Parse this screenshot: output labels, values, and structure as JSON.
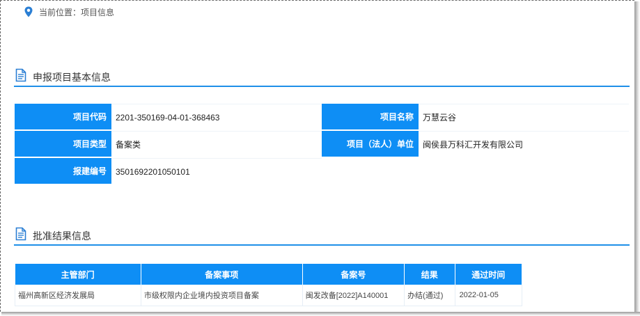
{
  "breadcrumb": {
    "text": "当前位置：项目信息",
    "icon": "location-pin-icon"
  },
  "colors": {
    "accent": "#0e8ef5",
    "rule": "#1e8fe8"
  },
  "basic_section": {
    "title": "申报项目基本信息",
    "fields": {
      "code_label": "项目代码",
      "code_value": "2201-350169-04-01-368463",
      "name_label": "项目名称",
      "name_value": "万慧云谷",
      "type_label": "项目类型",
      "type_value": "备案类",
      "unit_label": "项目（法人）单位",
      "unit_value": "闽侯县万科汇开发有限公司",
      "report_label": "报建编号",
      "report_value": "3501692201050101"
    }
  },
  "result_section": {
    "title": "批准结果信息",
    "columns": [
      "主管部门",
      "备案事项",
      "备案号",
      "结果",
      "通过时间"
    ],
    "rows": [
      [
        "福州高新区经济发展局",
        "市级权限内企业境内投资项目备案",
        "闽发改备[2022]A140001",
        "办结(通过)",
        "2022-01-05"
      ]
    ]
  }
}
